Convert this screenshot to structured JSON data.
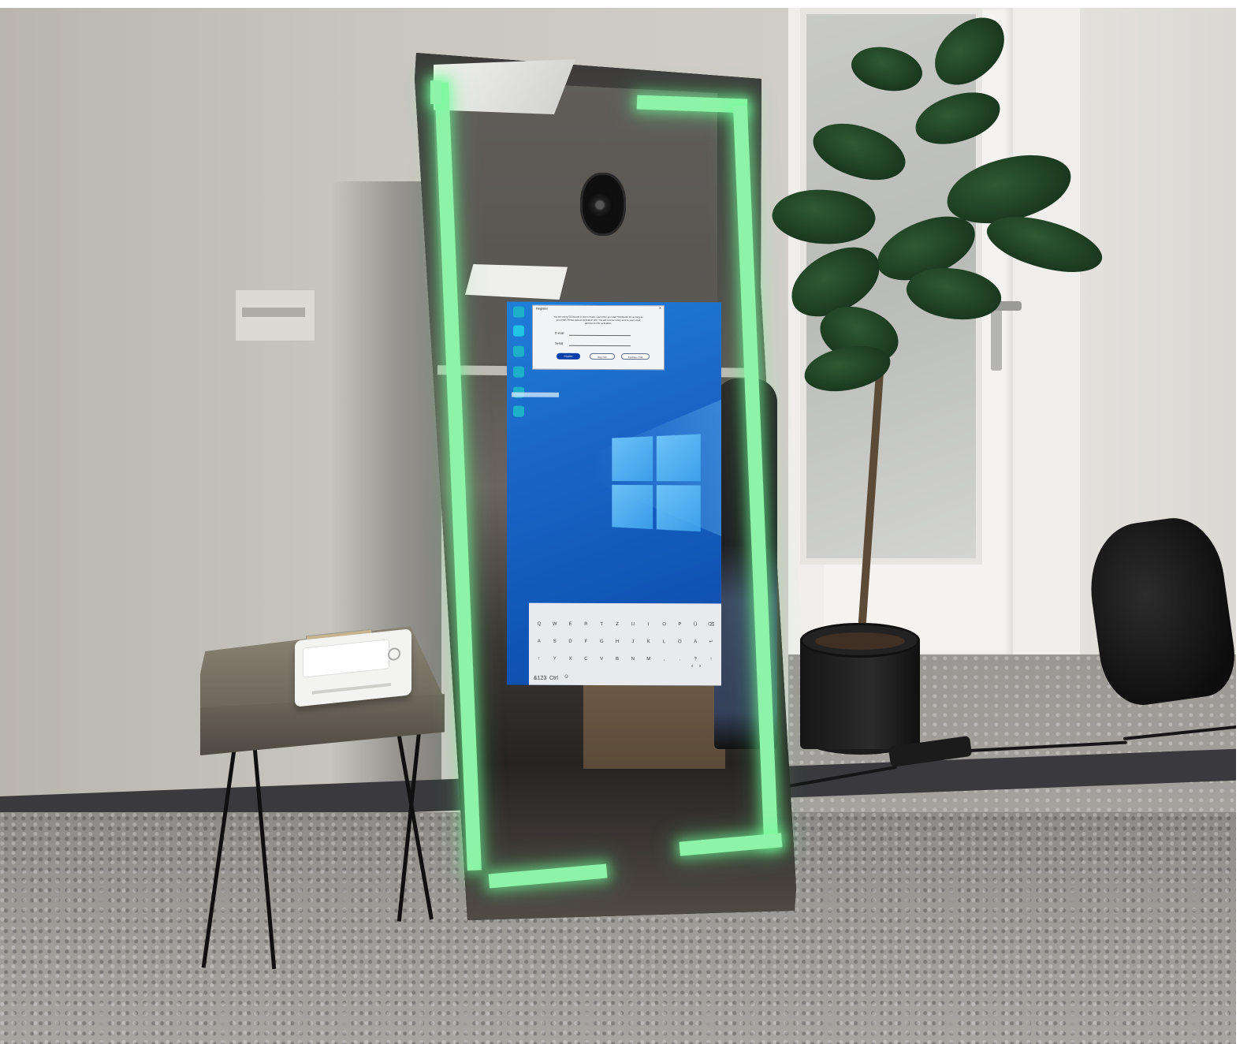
{
  "screen": {
    "dialog": {
      "title": "Register",
      "close": "×",
      "message": "You are using SEEBooth in demo mode. Each time you start SEEBooth for as long as you retail. Please add an activation link. You will receive a key sent to your email address for the activation.",
      "email_label": "E-mail",
      "serial_label": "Serial",
      "buttons": [
        "Register",
        "Buy now",
        "Continue Trial"
      ]
    },
    "keyboard": {
      "rows": [
        [
          "Q",
          "W",
          "E",
          "R",
          "T",
          "Z",
          "U",
          "I",
          "O",
          "P",
          "Ü",
          "⌫"
        ],
        [
          "A",
          "S",
          "D",
          "F",
          "G",
          "H",
          "J",
          "K",
          "L",
          "Ö",
          "Ä",
          "↵"
        ],
        [
          "↑",
          "Y",
          "X",
          "C",
          "V",
          "B",
          "N",
          "M",
          ",",
          ".",
          "?",
          "↑"
        ]
      ],
      "bottom_left": "&123",
      "ctrl": "Ctrl",
      "emoji": "☺",
      "arrows": [
        "‹",
        "›"
      ]
    }
  },
  "colors": {
    "neon": "#8df3a8",
    "desktop": "#1a66c7",
    "primary_button": "#0b3fa8"
  }
}
